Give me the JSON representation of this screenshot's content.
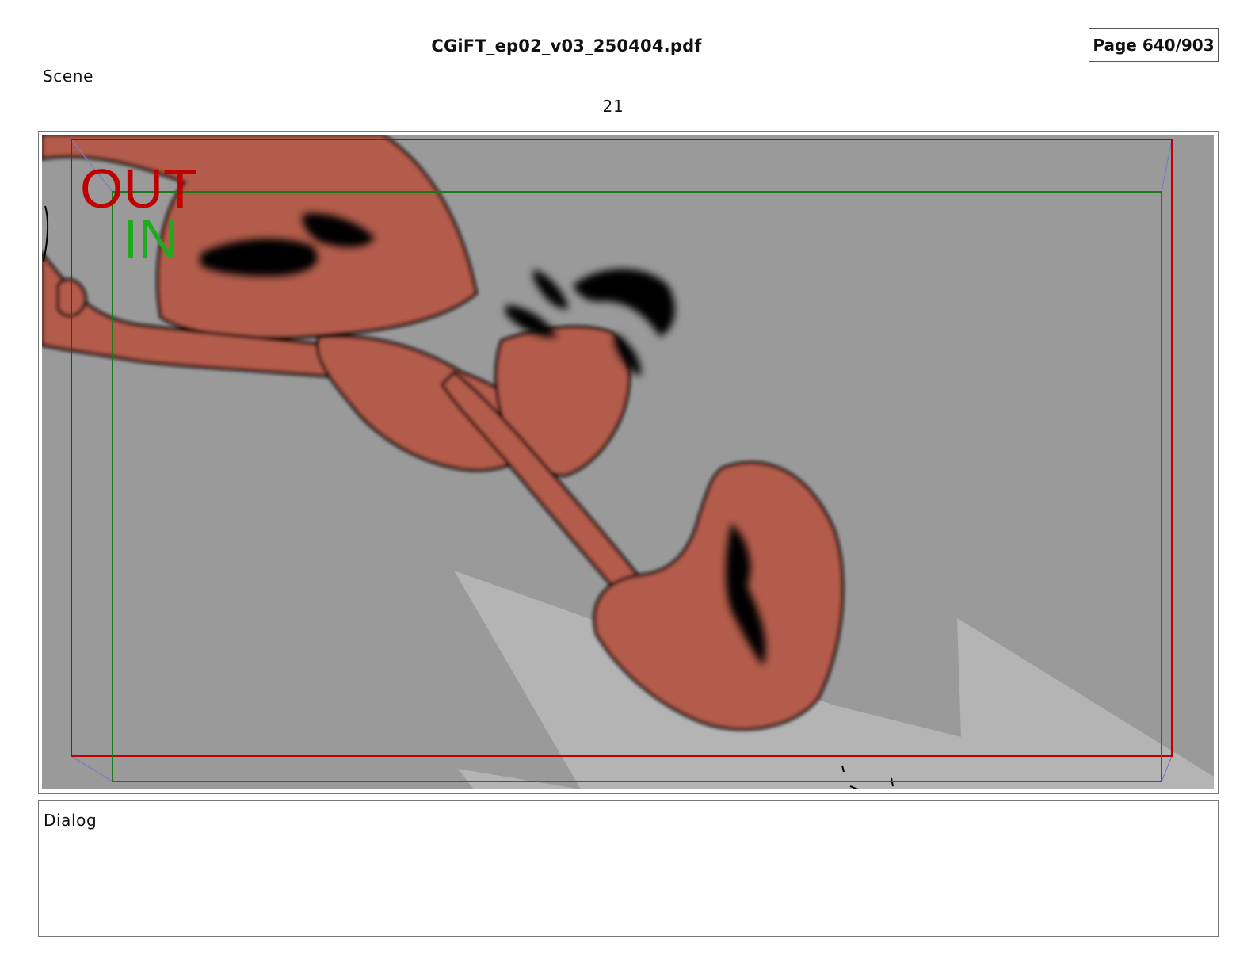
{
  "header": {
    "file_name": "CGiFT_ep02_v03_250404.pdf",
    "page_indicator": "Page 640/903"
  },
  "scene": {
    "label": "Scene",
    "number": "21"
  },
  "panel": {
    "frame_labels": {
      "out": "OUT",
      "in": "IN"
    },
    "colors": {
      "background": "#9a9a9a",
      "shadow_light": "#b4b4b4",
      "character_fill": "#b35b4c",
      "ink": "#000000",
      "out_frame": "#c00000",
      "in_frame": "#1a7a1a",
      "camera_path": "#7a7acc"
    }
  },
  "dialog": {
    "label": "Dialog",
    "text": ""
  }
}
